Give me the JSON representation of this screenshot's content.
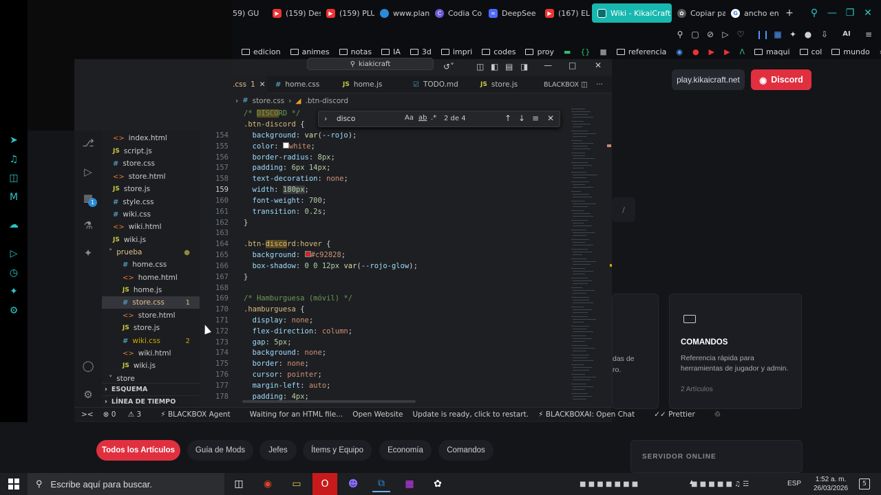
{
  "browser": {
    "tabs": [
      {
        "label": "59) GU",
        "color": "#e33"
      },
      {
        "label": "(159) Des",
        "color": "#e33"
      },
      {
        "label": "(159) PLU",
        "color": "#e33"
      },
      {
        "label": "www.plan",
        "color": "#2a8bd8"
      },
      {
        "label": "Codia Co",
        "color": "#6b5bd6"
      },
      {
        "label": "DeepSee",
        "color": "#4d6bfe"
      },
      {
        "label": "(167) EL C",
        "color": "#e33"
      },
      {
        "label": "Wiki - KikaiCraft",
        "color": "#fff"
      },
      {
        "label": "Copiar pa",
        "color": "#cfcfcf"
      },
      {
        "label": "ancho en",
        "color": "#34a853"
      }
    ],
    "ai_label": "AI",
    "bookmarks": [
      "edicion",
      "animes",
      "notas",
      "IA",
      "3d",
      "impri",
      "codes",
      "proy",
      "referencia",
      "maqui",
      "col",
      "mundo"
    ]
  },
  "site": {
    "play_label": "play.kikaicraft.net",
    "discord_label": "Discord",
    "card_title": "COMANDOS",
    "card_desc": "Referencia rápida para herramientas de jugador y admin.",
    "card_count": "2 Artículos",
    "partial_text_1": "das de",
    "partial_text_2": "ro.",
    "server_status": "SERVIDOR ONLINE",
    "slash": "/",
    "categories": [
      "Todos los Artículos",
      "Guía de Mods",
      "Jefes",
      "Ítems y Equipo",
      "Economía",
      "Comandos"
    ]
  },
  "vscode": {
    "search_text": "kiakicraft",
    "tabs": [
      {
        "label": ".css",
        "badge": "1",
        "type": "css"
      },
      {
        "label": "home.css",
        "type": "css"
      },
      {
        "label": "home.js",
        "type": "js"
      },
      {
        "label": "TODO.md",
        "type": "md"
      },
      {
        "label": "store.js",
        "type": "js"
      }
    ],
    "blackbox_label": "BLACKBOX",
    "breadcrumb": {
      "file": "store.css",
      "symbol": ".btn-discord"
    },
    "find": {
      "query": "disco",
      "count": "2 de 4"
    },
    "explorer": [
      {
        "label": "index.html",
        "type": "html"
      },
      {
        "label": "script.js",
        "type": "js"
      },
      {
        "label": "store.css",
        "type": "css"
      },
      {
        "label": "store.html",
        "type": "html"
      },
      {
        "label": "store.js",
        "type": "js"
      },
      {
        "label": "style.css",
        "type": "css"
      },
      {
        "label": "wiki.css",
        "type": "css"
      },
      {
        "label": "wiki.html",
        "type": "html"
      },
      {
        "label": "wiki.js",
        "type": "js"
      },
      {
        "label": "prueba",
        "type": "folder"
      },
      {
        "label": "home.css",
        "type": "css"
      },
      {
        "label": "home.html",
        "type": "html"
      },
      {
        "label": "home.js",
        "type": "js"
      },
      {
        "label": "store.css",
        "type": "css",
        "badge": "1"
      },
      {
        "label": "store.html",
        "type": "html"
      },
      {
        "label": "store.js",
        "type": "js"
      },
      {
        "label": "wiki.css",
        "type": "css",
        "badge": "2"
      },
      {
        "label": "wiki.html",
        "type": "html"
      },
      {
        "label": "wiki.js",
        "type": "js"
      },
      {
        "label": "store",
        "type": "folder"
      }
    ],
    "outline_label": "ESQUEMA",
    "timeline_label": "LÍNEA DE TIEMPO",
    "line_numbers": [
      "",
      "",
      "154",
      "155",
      "156",
      "157",
      "158",
      "159",
      "160",
      "161",
      "162",
      "163",
      "164",
      "165",
      "166",
      "167",
      "168",
      "169",
      "170",
      "171",
      "172",
      "173",
      "174",
      "175",
      "176",
      "177",
      "178"
    ],
    "status": {
      "problems": "0",
      "warnings": "3",
      "agent": "BLACKBOX Agent",
      "waiting": "Waiting for an HTML file...",
      "open_website": "Open Website",
      "update": "Update is ready, click to restart.",
      "bb_chat": "BLACKBOXAI: Open Chat",
      "prettier": "Prettier"
    }
  },
  "taskbar": {
    "search_placeholder": "Escribe aquí para buscar.",
    "lang": "ESP",
    "time": "1:52 a. m.",
    "date": "26/03/2026",
    "notif": "5"
  }
}
